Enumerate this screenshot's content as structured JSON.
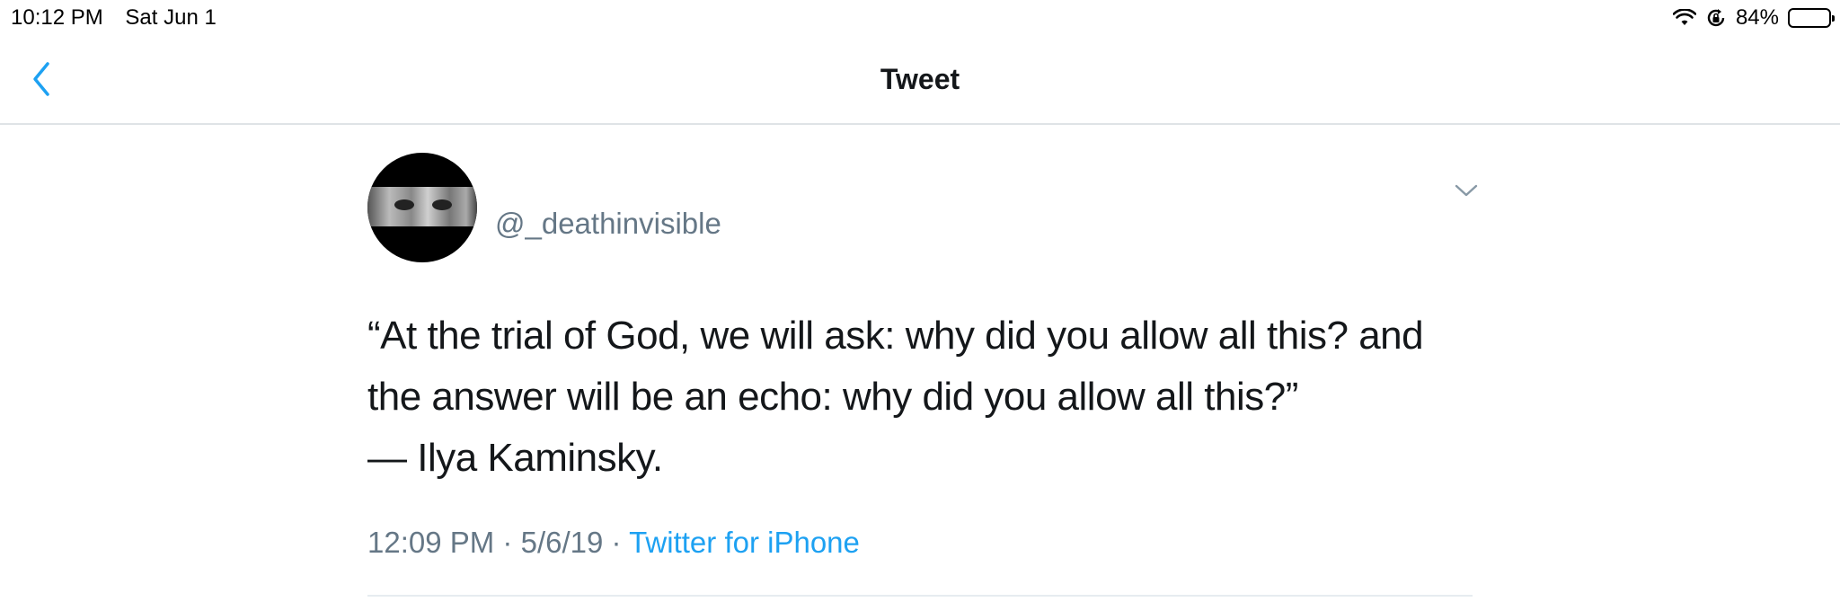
{
  "status_bar": {
    "time": "10:12 PM",
    "date": "Sat Jun 1",
    "battery_percent": "84%",
    "battery_level": 0.84,
    "icons": [
      "wifi-icon",
      "rotation-lock-icon",
      "battery-icon"
    ]
  },
  "nav": {
    "title": "Tweet",
    "back_icon": "chevron-left-icon"
  },
  "tweet": {
    "handle": "@_deathinvisible",
    "text_lines": [
      "“At the trial of God, we will ask: why did you allow all this? and",
      "the answer will be an echo: why did you allow all this?”",
      "— Ilya Kaminsky."
    ],
    "time": "12:09 PM",
    "date": "5/6/19",
    "separator": "·",
    "source": "Twitter for iPhone"
  },
  "colors": {
    "accent": "#1da1f2",
    "secondary_text": "#657786",
    "primary_text": "#14171a",
    "divider": "#dfe3e6"
  }
}
